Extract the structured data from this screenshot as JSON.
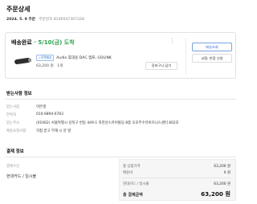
{
  "header": {
    "title": "주문상세",
    "order_date": "2024. 5. 9 주문",
    "order_number": "주문번호 8100047307328"
  },
  "order_card": {
    "status_label": "배송완료",
    "separator": " · ",
    "eta": "5/10(금) 도착",
    "menu_icon": "more-vertical-icon",
    "badge": "✓로켓배송",
    "product_name": "Audio 휴대용 DAC 앰프, GOLINK",
    "price": "63,200 원",
    "quantity": "1개",
    "add_to_cart_label": "장바구니 담기",
    "track_button_label": "배송조회",
    "return_button_label": "교환, 반품 신청"
  },
  "recipient": {
    "section_title": "받는사람 정보",
    "rows": [
      {
        "label": "받는사람",
        "value": "이본생"
      },
      {
        "label": "연락처",
        "value": "010-6894-6783"
      },
      {
        "label": "받는주소",
        "value": "(01062) 서울특별시 강북구 번동 449-1 북한산스카이빌딩 8층 오호부수유비즈니스센터 802호"
      },
      {
        "label": "배송요청사항",
        "value": "직접 받고 부재 시 문 앞"
      }
    ]
  },
  "payment": {
    "section_title": "결제 정보",
    "method_label": "결제수단",
    "method": "현대카드 / 일시불",
    "summary": {
      "total_product_label": "총 상품가격",
      "total_product_value": "63,200 원",
      "shipping_label": "배송비",
      "shipping_value": "0 원",
      "card_label": "현대카드 / 일시불",
      "card_value": "63,200 원",
      "grand_total_label": "총 결제금액",
      "grand_total_value": "63,200 원"
    }
  },
  "colors": {
    "eta_green": "#2ba24c",
    "track_blue": "#2e6ad2",
    "badge_blue": "#2a74d6"
  }
}
